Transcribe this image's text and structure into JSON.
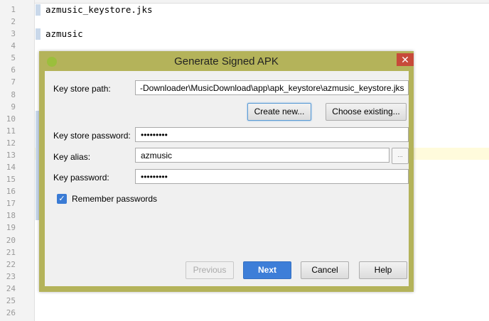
{
  "editor": {
    "line_numbers": [
      "1",
      "2",
      "3",
      "4",
      "5",
      "6",
      "7",
      "8",
      "9",
      "10",
      "11",
      "12",
      "13",
      "14",
      "15",
      "16",
      "17",
      "18",
      "19",
      "20",
      "21",
      "22",
      "23",
      "24",
      "25",
      "26"
    ],
    "lines": [
      "azmusic_keystore.jks",
      "",
      "azmusic"
    ]
  },
  "dialog": {
    "title": "Generate Signed APK",
    "close": "✕",
    "key_store_path_label": "Key store path:",
    "key_store_path": "-Downloader\\MusicDownload\\app\\apk_keystore\\azmusic_keystore.jks",
    "create_new": "Create new...",
    "choose_existing": "Choose existing...",
    "key_store_password_label": "Key store password:",
    "key_store_password": "•••••••••",
    "key_alias_label": "Key alias:",
    "key_alias": "azmusic",
    "alias_browse": "...",
    "key_password_label": "Key password:",
    "key_password": "•••••••••",
    "remember_label": "Remember passwords",
    "remember_checked": true,
    "previous": "Previous",
    "next": "Next",
    "cancel": "Cancel",
    "help": "Help"
  }
}
